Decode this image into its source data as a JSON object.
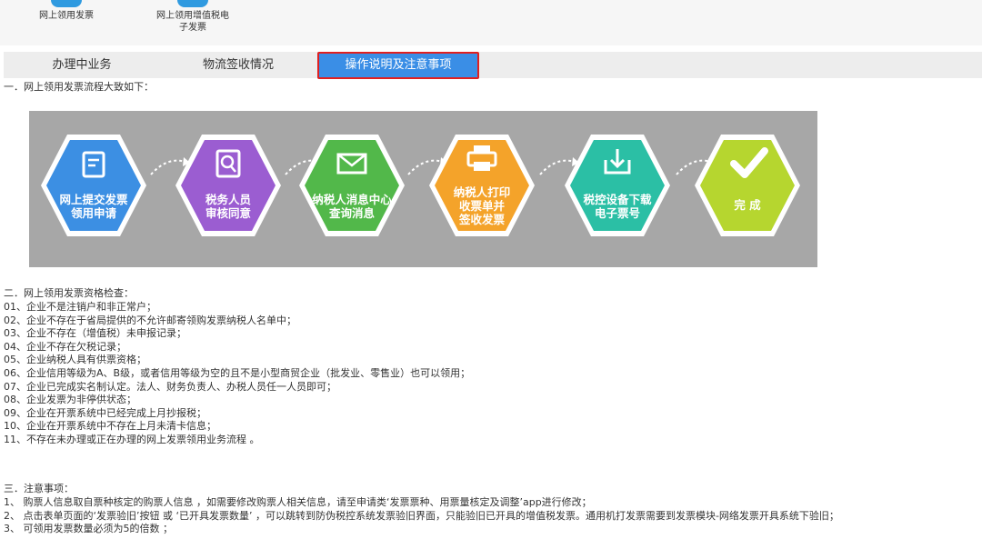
{
  "top": {
    "icons": [
      {
        "label": "网上领用发票"
      },
      {
        "label_line1": "网上领用增值税电",
        "label_line2": "子发票"
      }
    ]
  },
  "tabs": [
    {
      "label": "办理中业务"
    },
    {
      "label": "物流签收情况"
    },
    {
      "label": "操作说明及注意事项"
    }
  ],
  "section1": {
    "heading": "一．网上领用发票流程大致如下：",
    "steps": [
      {
        "line1": "网上提交发票",
        "line2": "领用申请",
        "color": "#3c8fe3"
      },
      {
        "line1": "税务人员",
        "line2": "审核同意",
        "color": "#9b5dd1"
      },
      {
        "line1": "纳税人消息中心",
        "line2": "查询消息",
        "color": "#52b84a"
      },
      {
        "line1": "纳税人打印",
        "line2": "收票单并",
        "line3": "签收发票",
        "color": "#f4a32a"
      },
      {
        "line1": "税控设备下载",
        "line2": "电子票号",
        "color": "#2bbfa5"
      },
      {
        "line1": "完 成",
        "color": "#b6d62f"
      }
    ]
  },
  "section2": {
    "heading": "二．网上领用发票资格检查：",
    "items": [
      "01、企业不是注销户和非正常户；",
      "02、企业不存在于省局提供的不允许邮寄领购发票纳税人名单中；",
      "03、企业不存在（增值税）未申报记录；",
      "04、企业不存在欠税记录；",
      "05、企业纳税人具有供票资格；",
      "06、企业信用等级为A、B级，或者信用等级为空的且不是小型商贸企业（批发业、零售业）也可以领用；",
      "07、企业已完成实名制认定。法人、财务负责人、办税人员任一人员即可；",
      "08、企业发票为非停供状态；",
      "09、企业在开票系统中已经完成上月抄报税；",
      "10、企业在开票系统中不存在上月未清卡信息；",
      "11、不存在未办理或正在办理的网上发票领用业务流程 。"
    ]
  },
  "section3": {
    "heading": "三．注意事项：",
    "items": [
      "1、 购票人信息取自票种核定的购票人信息 ，如需要修改购票人相关信息，请至申请类‘发票票种、用票量核定及调整’app进行修改；",
      "2、 点击表单页面的‘发票验旧’按钮 或 ‘已开具发票数量’ ，可以跳转到防伪税控系统发票验旧界面，只能验旧已开具的增值税发票。通用机打发票需要到发票模块-网络发票开具系统下验旧；",
      "3、 可领用发票数量必须为5的倍数 ；"
    ]
  }
}
